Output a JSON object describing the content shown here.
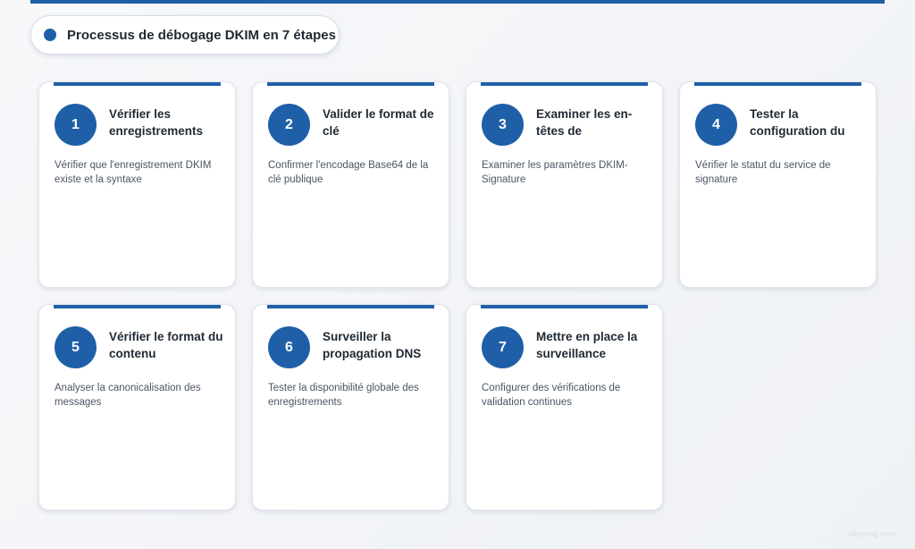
{
  "title": "Processus de débogage DKIM en 7 étapes",
  "steps": [
    {
      "number": "1",
      "title": "Vérifier les enregistrements",
      "description": "Vérifier que l'enregistrement DKIM existe et la syntaxe"
    },
    {
      "number": "2",
      "title": "Valider le format de clé",
      "description": "Confirmer l'encodage Base64 de la clé publique"
    },
    {
      "number": "3",
      "title": "Examiner les en-têtes de",
      "description": "Examiner les paramètres DKIM-Signature"
    },
    {
      "number": "4",
      "title": "Tester la configuration du",
      "description": "Vérifier le statut du service de signature"
    },
    {
      "number": "5",
      "title": "Vérifier le format du contenu",
      "description": "Analyser la canonicalisation des messages"
    },
    {
      "number": "6",
      "title": "Surveiller la propagation DNS",
      "description": "Tester la disponibilité globale des enregistrements"
    },
    {
      "number": "7",
      "title": "Mettre en place la surveillance",
      "description": "Configurer des vérifications de validation continues"
    }
  ],
  "watermark": "skyosag.com",
  "colors": {
    "accent": "#1f5fa8",
    "card": "#ffffff",
    "background": "#f3f5f8"
  }
}
